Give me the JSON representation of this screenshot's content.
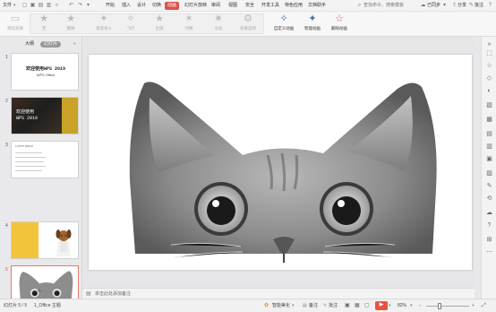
{
  "menu": {
    "file": "文件",
    "items": [
      "开始",
      "插入",
      "设计",
      "切换",
      "动画",
      "幻灯片放映",
      "审阅",
      "视图",
      "安全",
      "开发工具",
      "特色应用",
      "文档助手"
    ],
    "active_index": 4,
    "search": "查找命令、搜索模板",
    "sync": "已同步",
    "share": "分享",
    "comment": "批注"
  },
  "ribbon": {
    "preview": "预览效果",
    "effects": [
      "无",
      "擦除",
      "渐变进入",
      "飞行",
      "出现",
      "切换",
      "淡化",
      "效果选项"
    ],
    "custom_anim": "自定义动画",
    "smart_anim": "智能动画",
    "delete_anim": "删除动画"
  },
  "left_panel": {
    "tabs": [
      "大纲",
      "幻灯片"
    ],
    "slides": [
      {
        "num": "1",
        "title": "欢迎使用WPS 2019",
        "subtitle": "WPS Office"
      },
      {
        "num": "2",
        "title": "欢迎使用",
        "subtitle": "WPS 2019"
      },
      {
        "num": "3",
        "title": "Lorem ipsum"
      },
      {
        "num": "4"
      },
      {
        "num": "5"
      }
    ],
    "add": "+"
  },
  "notes": {
    "placeholder": "单击此处添加备注"
  },
  "status": {
    "slide": "幻灯片 5 / 5",
    "theme": "1_Office 主题",
    "beautify": "智能美化",
    "notes": "备注",
    "comment": "批注",
    "zoom": "82%"
  },
  "colors": {
    "accent": "#d9534a",
    "selection": "#e47a6b"
  }
}
